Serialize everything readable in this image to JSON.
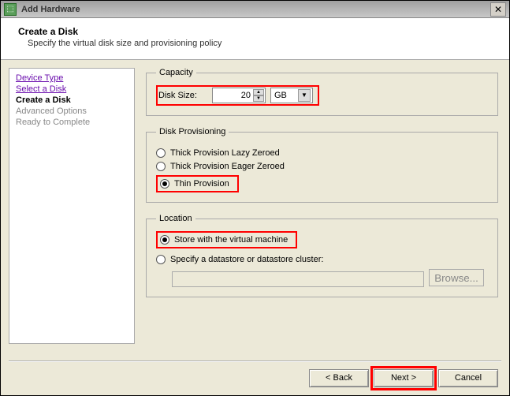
{
  "window": {
    "title": "Add Hardware"
  },
  "header": {
    "title": "Create a Disk",
    "subtitle": "Specify the virtual disk size and provisioning policy"
  },
  "nav": {
    "device_type": "Device Type",
    "select_disk": "Select a Disk",
    "create_disk": "Create a Disk",
    "advanced": "Advanced Options",
    "ready": "Ready to Complete"
  },
  "capacity": {
    "legend": "Capacity",
    "label": "Disk Size:",
    "value": "20",
    "unit": "GB"
  },
  "provisioning": {
    "legend": "Disk Provisioning",
    "thick_lazy": "Thick Provision Lazy Zeroed",
    "thick_eager": "Thick Provision Eager Zeroed",
    "thin": "Thin Provision"
  },
  "location": {
    "legend": "Location",
    "store_vm": "Store with the virtual machine",
    "specify_ds": "Specify a datastore or datastore cluster:",
    "browse": "Browse..."
  },
  "buttons": {
    "back": "< Back",
    "next": "Next >",
    "cancel": "Cancel"
  }
}
